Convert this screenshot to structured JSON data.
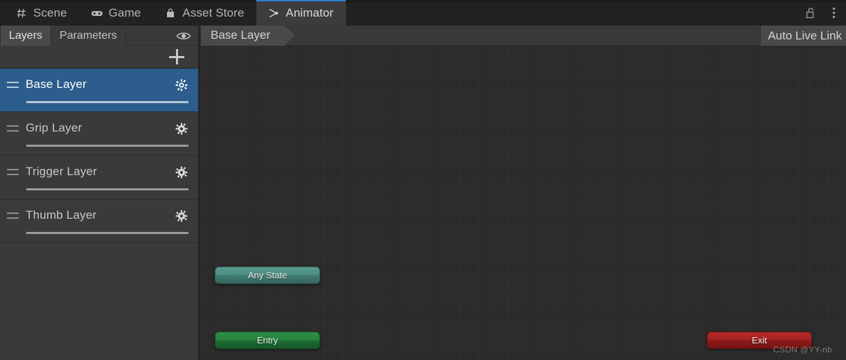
{
  "window": {
    "tabs": [
      {
        "label": "Scene",
        "icon": "grid-icon",
        "active": false
      },
      {
        "label": "Game",
        "icon": "gamepad-icon",
        "active": false
      },
      {
        "label": "Asset Store",
        "icon": "shopping-bag-icon",
        "active": false
      },
      {
        "label": "Animator",
        "icon": "animator-icon",
        "active": true
      }
    ],
    "lock_icon": "padlock-open-icon",
    "menu_icon": "kebab-menu-icon",
    "accent_color": "#2c7fd6"
  },
  "sidebar": {
    "segments": [
      {
        "label": "Layers",
        "active": true
      },
      {
        "label": "Parameters",
        "active": false
      }
    ],
    "visibility_icon": "eye-icon",
    "add_layer_icon": "plus-icon",
    "layers": [
      {
        "name": "Base Layer",
        "selected": true,
        "settings_icon": "gear-icon",
        "drag_icon": "drag-handle-icon"
      },
      {
        "name": "Grip Layer",
        "selected": false,
        "settings_icon": "gear-icon",
        "drag_icon": "drag-handle-icon"
      },
      {
        "name": "Trigger Layer",
        "selected": false,
        "settings_icon": "gear-icon",
        "drag_icon": "drag-handle-icon"
      },
      {
        "name": "Thumb Layer",
        "selected": false,
        "settings_icon": "gear-icon",
        "drag_icon": "drag-handle-icon"
      }
    ],
    "selected_color": "#2c5d8c"
  },
  "graph": {
    "breadcrumb": "Base Layer",
    "live_link_label": "Auto Live Link",
    "nodes": [
      {
        "label": "Any State",
        "type": "any-state",
        "color": "#4d8d81"
      },
      {
        "label": "Entry",
        "type": "entry",
        "color": "#27803f"
      },
      {
        "label": "Exit",
        "type": "exit",
        "color": "#a22222"
      }
    ],
    "watermark": "CSDN @YY-nb"
  }
}
